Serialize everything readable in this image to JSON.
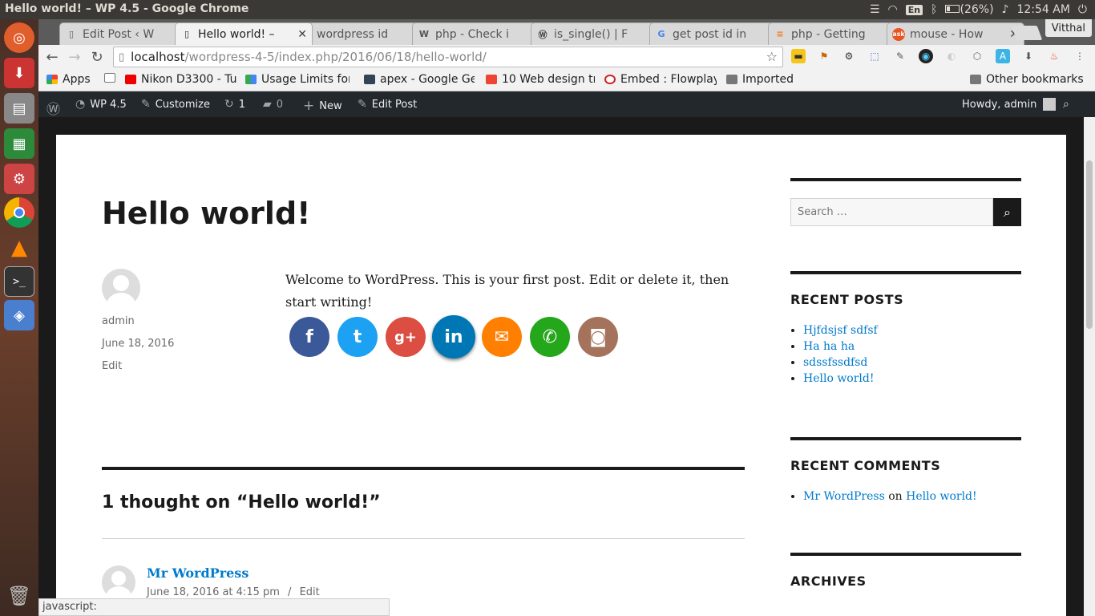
{
  "os": {
    "window_title": "Hello world! – WP 4.5 - Google Chrome",
    "battery": "(26%)",
    "clock": "12:54 AM",
    "keyboard": "En"
  },
  "browser": {
    "profile": "Vitthal",
    "tabs": [
      {
        "title": "Edit Post ‹ W",
        "icon": "page-icon",
        "active": false
      },
      {
        "title": "Hello world! –",
        "icon": "page-icon",
        "active": true
      },
      {
        "title": "wordpress id",
        "icon": "google-icon",
        "active": false
      },
      {
        "title": "php - Check i",
        "icon": "wikipedia-icon",
        "active": false
      },
      {
        "title": "is_single() | F",
        "icon": "wordpress-icon",
        "active": false
      },
      {
        "title": "get post id in",
        "icon": "google-icon",
        "active": false
      },
      {
        "title": "php - Getting",
        "icon": "stackoverflow-icon",
        "active": false
      },
      {
        "title": "mouse - How",
        "icon": "askubuntu-icon",
        "active": false
      }
    ],
    "url_host": "localhost",
    "url_path": "/wordpress-4-5/index.php/2016/06/18/hello-world/",
    "bookmarks": [
      {
        "label": "Apps"
      },
      {
        "label": ""
      },
      {
        "label": "Nikon D3300 - Tu"
      },
      {
        "label": "Usage Limits for"
      },
      {
        "label": "apex - Google Ge"
      },
      {
        "label": "10 Web design tr"
      },
      {
        "label": "Embed : Flowplay"
      },
      {
        "label": "Imported"
      }
    ],
    "other_bookmarks": "Other bookmarks",
    "status_text": "javascript:"
  },
  "adminbar": {
    "site": "WP 4.5",
    "customize": "Customize",
    "updates": "1",
    "comments": "0",
    "new": "New",
    "edit_post": "Edit Post",
    "howdy": "Howdy, admin"
  },
  "post": {
    "title": "Hello world!",
    "author": "admin",
    "date": "June 18, 2016",
    "edit": "Edit",
    "body": "Welcome to WordPress. This is your first post. Edit or delete it, then start writing!",
    "share_buttons": [
      {
        "name": "facebook",
        "glyph": "f",
        "color": "#3b5998"
      },
      {
        "name": "twitter",
        "glyph": "t",
        "color": "#1da1f2"
      },
      {
        "name": "google-plus",
        "glyph": "g+",
        "color": "#dc4e41"
      },
      {
        "name": "linkedin",
        "glyph": "in",
        "color": "#0077b5"
      },
      {
        "name": "email",
        "glyph": "✉",
        "color": "#ff7f00"
      },
      {
        "name": "whatsapp",
        "glyph": "✆",
        "color": "#25a71b"
      },
      {
        "name": "instagram",
        "glyph": "◙",
        "color": "#a5735b"
      }
    ]
  },
  "comments": {
    "heading": "1 thought on “Hello world!”",
    "items": [
      {
        "author": "Mr WordPress",
        "date": "June 18, 2016 at 4:15 pm",
        "sep": "/",
        "edit": "Edit"
      }
    ]
  },
  "sidebar": {
    "search_placeholder": "Search …",
    "recent_posts_title": "RECENT POSTS",
    "recent_posts": [
      "Hjfdsjsf sdfsf",
      "Ha ha ha",
      "sdssfssdfsd",
      "Hello world!"
    ],
    "recent_comments_title": "RECENT COMMENTS",
    "recent_comment": {
      "author": "Mr WordPress",
      "on": "on",
      "post": "Hello world!"
    },
    "archives_title": "ARCHIVES"
  }
}
